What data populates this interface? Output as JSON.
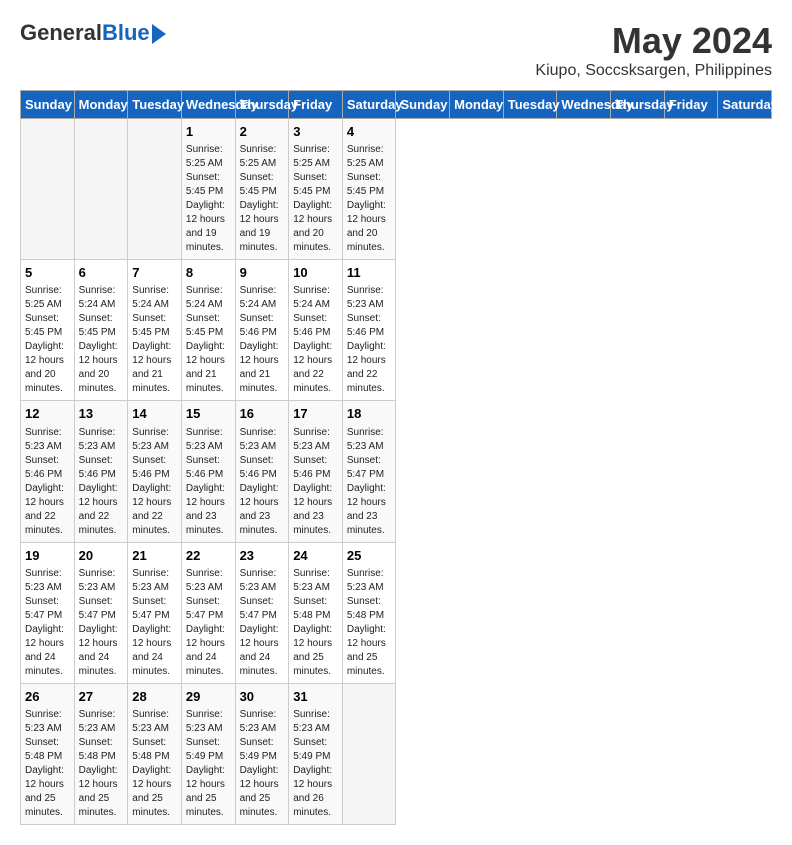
{
  "header": {
    "logo_general": "General",
    "logo_blue": "Blue",
    "month": "May 2024",
    "location": "Kiupo, Soccsksargen, Philippines"
  },
  "days_of_week": [
    "Sunday",
    "Monday",
    "Tuesday",
    "Wednesday",
    "Thursday",
    "Friday",
    "Saturday"
  ],
  "weeks": [
    [
      {
        "day": "",
        "info": ""
      },
      {
        "day": "",
        "info": ""
      },
      {
        "day": "",
        "info": ""
      },
      {
        "day": "1",
        "info": "Sunrise: 5:25 AM\nSunset: 5:45 PM\nDaylight: 12 hours\nand 19 minutes."
      },
      {
        "day": "2",
        "info": "Sunrise: 5:25 AM\nSunset: 5:45 PM\nDaylight: 12 hours\nand 19 minutes."
      },
      {
        "day": "3",
        "info": "Sunrise: 5:25 AM\nSunset: 5:45 PM\nDaylight: 12 hours\nand 20 minutes."
      },
      {
        "day": "4",
        "info": "Sunrise: 5:25 AM\nSunset: 5:45 PM\nDaylight: 12 hours\nand 20 minutes."
      }
    ],
    [
      {
        "day": "5",
        "info": "Sunrise: 5:25 AM\nSunset: 5:45 PM\nDaylight: 12 hours\nand 20 minutes."
      },
      {
        "day": "6",
        "info": "Sunrise: 5:24 AM\nSunset: 5:45 PM\nDaylight: 12 hours\nand 20 minutes."
      },
      {
        "day": "7",
        "info": "Sunrise: 5:24 AM\nSunset: 5:45 PM\nDaylight: 12 hours\nand 21 minutes."
      },
      {
        "day": "8",
        "info": "Sunrise: 5:24 AM\nSunset: 5:45 PM\nDaylight: 12 hours\nand 21 minutes."
      },
      {
        "day": "9",
        "info": "Sunrise: 5:24 AM\nSunset: 5:46 PM\nDaylight: 12 hours\nand 21 minutes."
      },
      {
        "day": "10",
        "info": "Sunrise: 5:24 AM\nSunset: 5:46 PM\nDaylight: 12 hours\nand 22 minutes."
      },
      {
        "day": "11",
        "info": "Sunrise: 5:23 AM\nSunset: 5:46 PM\nDaylight: 12 hours\nand 22 minutes."
      }
    ],
    [
      {
        "day": "12",
        "info": "Sunrise: 5:23 AM\nSunset: 5:46 PM\nDaylight: 12 hours\nand 22 minutes."
      },
      {
        "day": "13",
        "info": "Sunrise: 5:23 AM\nSunset: 5:46 PM\nDaylight: 12 hours\nand 22 minutes."
      },
      {
        "day": "14",
        "info": "Sunrise: 5:23 AM\nSunset: 5:46 PM\nDaylight: 12 hours\nand 22 minutes."
      },
      {
        "day": "15",
        "info": "Sunrise: 5:23 AM\nSunset: 5:46 PM\nDaylight: 12 hours\nand 23 minutes."
      },
      {
        "day": "16",
        "info": "Sunrise: 5:23 AM\nSunset: 5:46 PM\nDaylight: 12 hours\nand 23 minutes."
      },
      {
        "day": "17",
        "info": "Sunrise: 5:23 AM\nSunset: 5:46 PM\nDaylight: 12 hours\nand 23 minutes."
      },
      {
        "day": "18",
        "info": "Sunrise: 5:23 AM\nSunset: 5:47 PM\nDaylight: 12 hours\nand 23 minutes."
      }
    ],
    [
      {
        "day": "19",
        "info": "Sunrise: 5:23 AM\nSunset: 5:47 PM\nDaylight: 12 hours\nand 24 minutes."
      },
      {
        "day": "20",
        "info": "Sunrise: 5:23 AM\nSunset: 5:47 PM\nDaylight: 12 hours\nand 24 minutes."
      },
      {
        "day": "21",
        "info": "Sunrise: 5:23 AM\nSunset: 5:47 PM\nDaylight: 12 hours\nand 24 minutes."
      },
      {
        "day": "22",
        "info": "Sunrise: 5:23 AM\nSunset: 5:47 PM\nDaylight: 12 hours\nand 24 minutes."
      },
      {
        "day": "23",
        "info": "Sunrise: 5:23 AM\nSunset: 5:47 PM\nDaylight: 12 hours\nand 24 minutes."
      },
      {
        "day": "24",
        "info": "Sunrise: 5:23 AM\nSunset: 5:48 PM\nDaylight: 12 hours\nand 25 minutes."
      },
      {
        "day": "25",
        "info": "Sunrise: 5:23 AM\nSunset: 5:48 PM\nDaylight: 12 hours\nand 25 minutes."
      }
    ],
    [
      {
        "day": "26",
        "info": "Sunrise: 5:23 AM\nSunset: 5:48 PM\nDaylight: 12 hours\nand 25 minutes."
      },
      {
        "day": "27",
        "info": "Sunrise: 5:23 AM\nSunset: 5:48 PM\nDaylight: 12 hours\nand 25 minutes."
      },
      {
        "day": "28",
        "info": "Sunrise: 5:23 AM\nSunset: 5:48 PM\nDaylight: 12 hours\nand 25 minutes."
      },
      {
        "day": "29",
        "info": "Sunrise: 5:23 AM\nSunset: 5:49 PM\nDaylight: 12 hours\nand 25 minutes."
      },
      {
        "day": "30",
        "info": "Sunrise: 5:23 AM\nSunset: 5:49 PM\nDaylight: 12 hours\nand 25 minutes."
      },
      {
        "day": "31",
        "info": "Sunrise: 5:23 AM\nSunset: 5:49 PM\nDaylight: 12 hours\nand 26 minutes."
      },
      {
        "day": "",
        "info": ""
      }
    ]
  ]
}
